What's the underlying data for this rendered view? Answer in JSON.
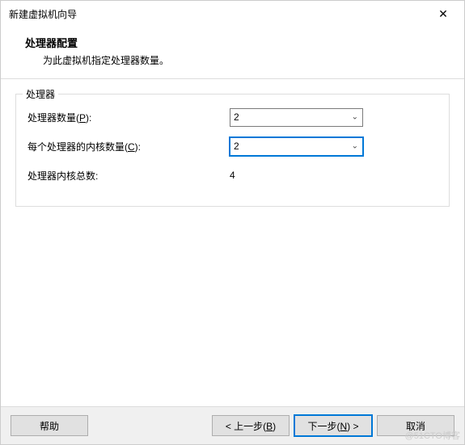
{
  "window": {
    "title": "新建虚拟机向导"
  },
  "header": {
    "title": "处理器配置",
    "subtitle": "为此虚拟机指定处理器数量。"
  },
  "group": {
    "legend": "处理器",
    "rows": {
      "proc_count": {
        "label_pre": "处理器数量(",
        "hotkey": "P",
        "label_post": "):",
        "value": "2"
      },
      "cores_per": {
        "label_pre": "每个处理器的内核数量(",
        "hotkey": "C",
        "label_post": "):",
        "value": "2"
      },
      "total": {
        "label": "处理器内核总数:",
        "value": "4"
      }
    }
  },
  "footer": {
    "help": "帮助",
    "back_pre": "< 上一步(",
    "back_hotkey": "B",
    "back_post": ")",
    "next_pre": "下一步(",
    "next_hotkey": "N",
    "next_post": ") >",
    "cancel": "取消"
  },
  "watermark": "@51CTO博客"
}
